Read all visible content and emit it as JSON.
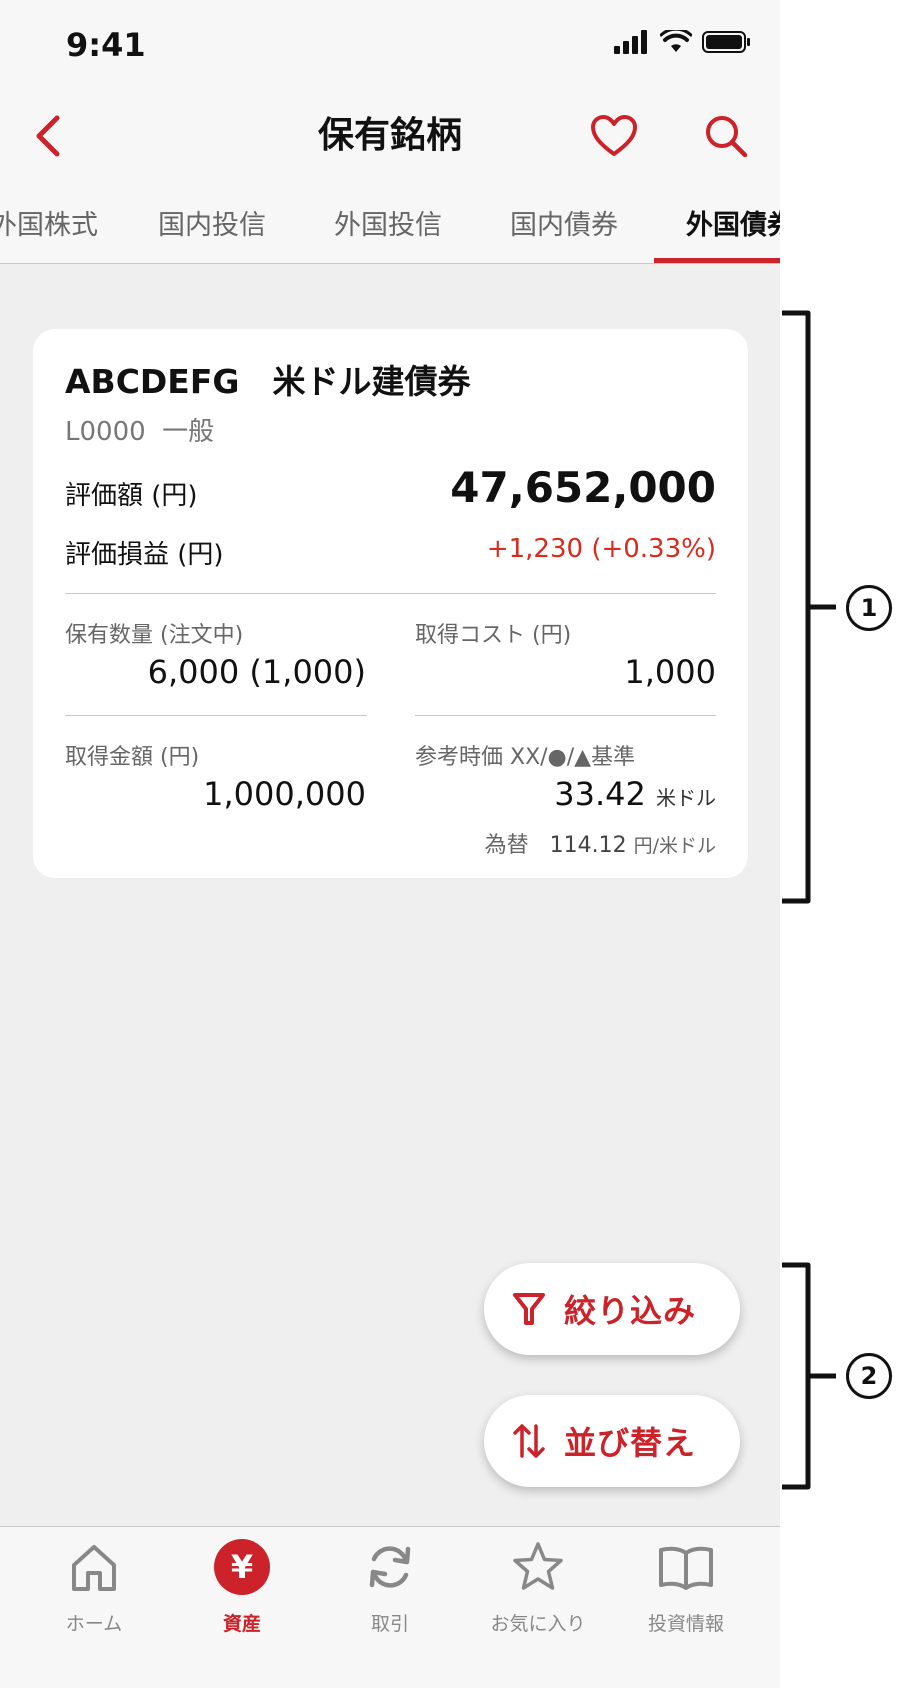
{
  "status_bar": {
    "time": "9:41"
  },
  "nav": {
    "title": "保有銘柄"
  },
  "tabs": [
    {
      "label": "外国株式",
      "active": false
    },
    {
      "label": "国内投信",
      "active": false
    },
    {
      "label": "外国投信",
      "active": false
    },
    {
      "label": "国内債券",
      "active": false
    },
    {
      "label": "外国債券",
      "active": true
    }
  ],
  "card": {
    "title": "ABCDEFG　米ドル建債券",
    "subtitle": "L0000  一般",
    "eval_label": "評価額 (円)",
    "eval_value": "47,652,000",
    "pl_label": "評価損益 (円)",
    "pl_value": "+1,230 (+0.33%)",
    "qty_label": "保有数量 (注文中)",
    "qty_value": "6,000 (1,000)",
    "cost_label": "取得コスト (円)",
    "cost_value": "1,000",
    "amount_label": "取得金額 (円)",
    "amount_value": "1,000,000",
    "ref_label": "参考時価 XX/●/▲基準",
    "ref_value": "33.42",
    "ref_unit": "米ドル",
    "fx_label": "為替",
    "fx_value": "114.12",
    "fx_unit": "円/米ドル"
  },
  "buttons": {
    "filter": "絞り込み",
    "sort": "並び替え"
  },
  "bottom_nav": [
    {
      "label": "ホーム",
      "icon": "home-icon",
      "active": false
    },
    {
      "label": "資産",
      "icon": "yen-icon",
      "active": true
    },
    {
      "label": "取引",
      "icon": "refresh-icon",
      "active": false
    },
    {
      "label": "お気に入り",
      "icon": "star-icon",
      "active": false
    },
    {
      "label": "投資情報",
      "icon": "book-icon",
      "active": false
    }
  ],
  "annotations": {
    "callout_1": "1",
    "callout_2": "2"
  },
  "colors": {
    "accent": "#cc2229",
    "profit": "#d62b1e",
    "background": "#efefef"
  }
}
